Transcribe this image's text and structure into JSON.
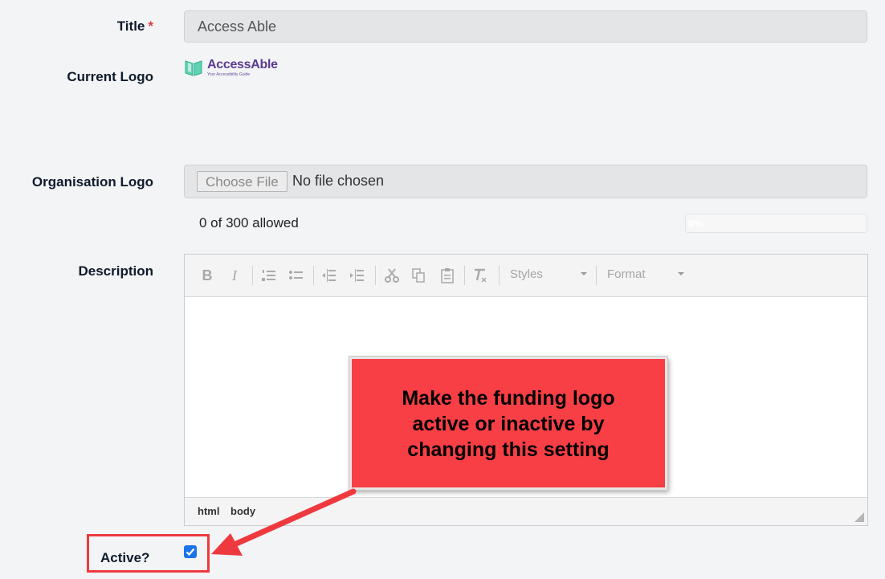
{
  "form": {
    "title_label": "Title",
    "required_marker": "*",
    "title_value": "Access Able",
    "current_logo_label": "Current Logo",
    "logo": {
      "name": "AccessAble",
      "tagline": "Your Accessibility Guide",
      "icon": "open-book-icon"
    },
    "org_logo_label": "Organisation Logo",
    "file_button": "Choose File",
    "file_status": "No file chosen",
    "allowed_text": "0 of 300 allowed",
    "progress": {
      "label": "0%",
      "value": 0
    },
    "description_label": "Description",
    "editor": {
      "toolbar": {
        "bold": "B",
        "italic": "I",
        "styles": "Styles",
        "format": "Format"
      },
      "path": [
        "html",
        "body"
      ]
    },
    "active_label": "Active?",
    "active_checked": true
  },
  "annotation": {
    "lines": [
      "Make the funding logo",
      "active or inactive by",
      "changing this setting"
    ],
    "color": "#f73f45"
  },
  "colors": {
    "accent": "#1a73e8",
    "required": "#e0393e",
    "highlight": "#ee3a3f"
  }
}
